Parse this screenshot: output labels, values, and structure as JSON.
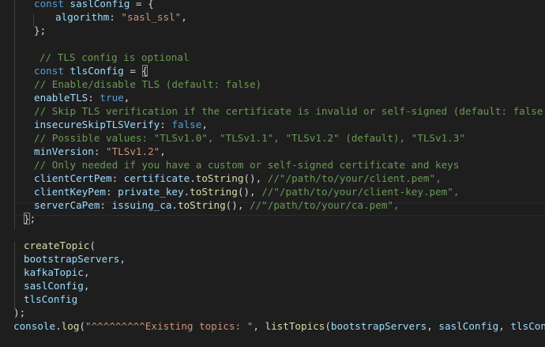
{
  "lines": [
    {
      "tokens": [
        [
          "kw",
          "const "
        ],
        [
          "var",
          "saslConfig"
        ],
        [
          "pun",
          " = {"
        ]
      ]
    },
    {
      "tokens": [
        [
          "var",
          "algorithm"
        ],
        [
          "pun",
          ": "
        ],
        [
          "str",
          "\"sasl_ssl\""
        ],
        [
          "pun",
          ","
        ]
      ]
    },
    {
      "tokens": [
        [
          "pun",
          "};"
        ]
      ]
    },
    {
      "tokens": []
    },
    {
      "tokens": [
        [
          "cmt",
          "// TLS config is optional"
        ]
      ]
    },
    {
      "tokens": [
        [
          "kw",
          "const "
        ],
        [
          "var",
          "tlsConfig"
        ],
        [
          "pun",
          " = "
        ],
        [
          "pun",
          "{"
        ]
      ]
    },
    {
      "tokens": [
        [
          "cmt",
          "// Enable/disable TLS (default: false)"
        ]
      ]
    },
    {
      "tokens": [
        [
          "var",
          "enableTLS"
        ],
        [
          "pun",
          ": "
        ],
        [
          "bool",
          "true"
        ],
        [
          "pun",
          ","
        ]
      ]
    },
    {
      "tokens": [
        [
          "cmt",
          "// Skip TLS verification if the certificate is invalid or self-signed (default: false)"
        ]
      ]
    },
    {
      "tokens": [
        [
          "var",
          "insecureSkipTLSVerify"
        ],
        [
          "pun",
          ": "
        ],
        [
          "bool",
          "false"
        ],
        [
          "pun",
          ","
        ]
      ]
    },
    {
      "tokens": [
        [
          "cmt",
          "// Possible values: \"TLSv1.0\", \"TLSv1.1\", \"TLSv1.2\" (default), \"TLSv1.3\""
        ]
      ]
    },
    {
      "tokens": [
        [
          "var",
          "minVersion"
        ],
        [
          "pun",
          ": "
        ],
        [
          "str",
          "\"TLSv1.2\""
        ],
        [
          "pun",
          ","
        ]
      ]
    },
    {
      "tokens": [
        [
          "cmt",
          "// Only needed if you have a custom or self-signed certificate and keys"
        ]
      ]
    },
    {
      "tokens": [
        [
          "var",
          "clientCertPem"
        ],
        [
          "pun",
          ": "
        ],
        [
          "var",
          "certificate"
        ],
        [
          "pun",
          "."
        ],
        [
          "fn",
          "toString"
        ],
        [
          "pun",
          "(), "
        ],
        [
          "cmt",
          "//\"/path/to/your/client.pem\","
        ]
      ]
    },
    {
      "tokens": [
        [
          "var",
          "clientKeyPem"
        ],
        [
          "pun",
          ": "
        ],
        [
          "var",
          "private_key"
        ],
        [
          "pun",
          "."
        ],
        [
          "fn",
          "toString"
        ],
        [
          "pun",
          "(), "
        ],
        [
          "cmt",
          "//\"/path/to/your/client-key.pem\","
        ]
      ]
    },
    {
      "tokens": [
        [
          "var",
          "serverCaPem"
        ],
        [
          "pun",
          ": "
        ],
        [
          "var",
          "issuing_ca"
        ],
        [
          "pun",
          "."
        ],
        [
          "fn",
          "toString"
        ],
        [
          "pun",
          "(), "
        ],
        [
          "cmt",
          "//\"/path/to/your/ca.pem\","
        ]
      ]
    },
    {
      "tokens": [
        [
          "pun",
          "}"
        ],
        [
          "pun",
          ";"
        ]
      ]
    },
    {
      "tokens": []
    },
    {
      "tokens": [
        [
          "fn",
          "createTopic"
        ],
        [
          "pun",
          "("
        ]
      ]
    },
    {
      "tokens": [
        [
          "var",
          "bootstrapServers"
        ],
        [
          "pun",
          ","
        ]
      ]
    },
    {
      "tokens": [
        [
          "var",
          "kafkaTopic"
        ],
        [
          "pun",
          ","
        ]
      ]
    },
    {
      "tokens": [
        [
          "var",
          "saslConfig"
        ],
        [
          "pun",
          ","
        ]
      ]
    },
    {
      "tokens": [
        [
          "var",
          "tlsConfig"
        ]
      ]
    },
    {
      "tokens": [
        [
          "pun",
          ");"
        ]
      ]
    },
    {
      "tokens": [
        [
          "var",
          "console"
        ],
        [
          "pun",
          "."
        ],
        [
          "fn",
          "log"
        ],
        [
          "pun",
          "("
        ],
        [
          "str",
          "\"^^^^^^^^^Existing topics: \""
        ],
        [
          "pun",
          ", "
        ],
        [
          "fn",
          "listTopics"
        ],
        [
          "pun",
          "("
        ],
        [
          "var",
          "bootstrapServers"
        ],
        [
          "pun",
          ", "
        ],
        [
          "var",
          "saslConfig"
        ],
        [
          "pun",
          ", "
        ],
        [
          "var",
          "tlsConfig"
        ],
        [
          "pun",
          "));"
        ]
      ]
    }
  ]
}
